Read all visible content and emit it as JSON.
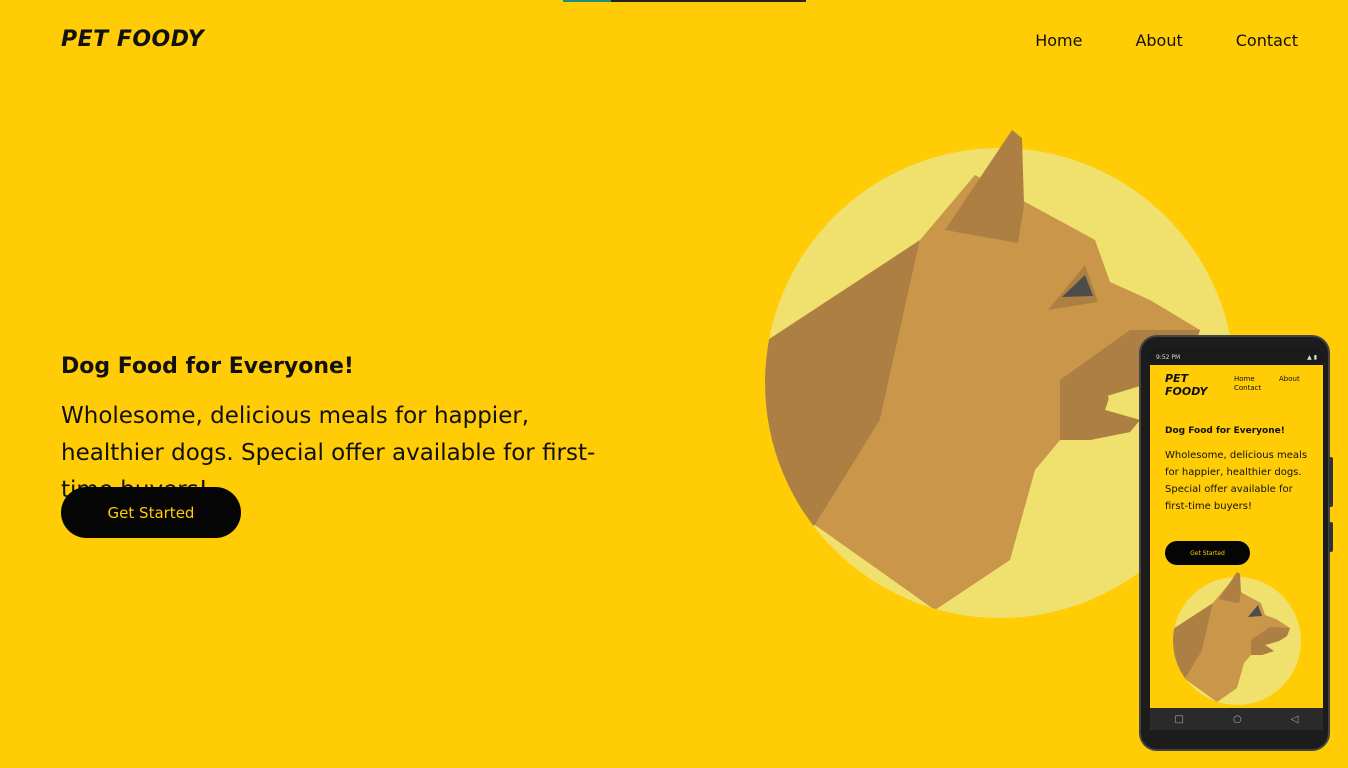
{
  "header": {
    "logo": "PET FOODY",
    "nav": [
      "Home",
      "About",
      "Contact"
    ]
  },
  "hero": {
    "title": "Dog Food for Everyone!",
    "description": "Wholesome, delicious meals for happier, healthier dogs. Special offer available for first-time buyers!",
    "cta_label": "Get Started"
  },
  "mobile_preview": {
    "status_time": "9:52 PM",
    "logo_line1": "PET",
    "logo_line2": "FOODY",
    "nav_home": "Home",
    "nav_about": "About",
    "nav_contact": "Contact",
    "title": "Dog Food for Everyone!",
    "description": "Wholesome, delicious meals for happier, healthier dogs. Special offer available for first-time buyers!",
    "cta_label": "Get Started",
    "nav_icons": [
      "square-icon",
      "circle-icon",
      "triangle-back-icon"
    ]
  },
  "colors": {
    "background": "#FFCC05",
    "circle": "#F0E06E",
    "dog_light": "#C9964A",
    "dog_dark": "#AD7F42",
    "button": "#050505",
    "button_text": "#FFCC05"
  }
}
